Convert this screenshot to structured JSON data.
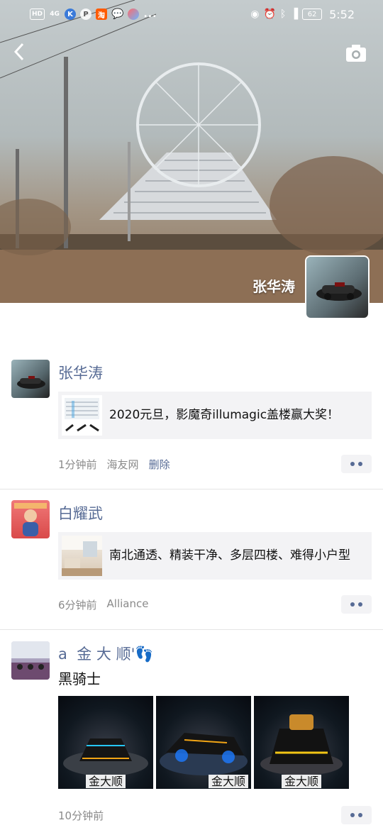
{
  "status_bar": {
    "left_icons": [
      "HD",
      "4G",
      "K",
      "P",
      "淘",
      "msg",
      "app",
      "..."
    ],
    "battery": "62",
    "time": "5:52"
  },
  "cover": {
    "user_name": "张华涛",
    "sky_color": "#bfc6c8"
  },
  "posts": [
    {
      "author": "张华涛",
      "link_title": "2020元旦，影魔奇illumagic盖楼赢大奖！",
      "time": "1分钟前",
      "source": "海友网",
      "delete_label": "删除"
    },
    {
      "author": "白耀武",
      "link_title": "南北通透、精装干净、多层四楼、难得小户型",
      "time": "6分钟前",
      "source": "Alliance"
    },
    {
      "author": "a  金 大 顺'",
      "text": "黑骑士",
      "photo_captions": [
        "金大顺",
        "金大顺",
        "金大顺"
      ],
      "time": "10分钟前"
    }
  ],
  "colors": {
    "name_link": "#576b95",
    "meta_gray": "#8a8a8a",
    "card_bg": "#f3f3f5"
  }
}
